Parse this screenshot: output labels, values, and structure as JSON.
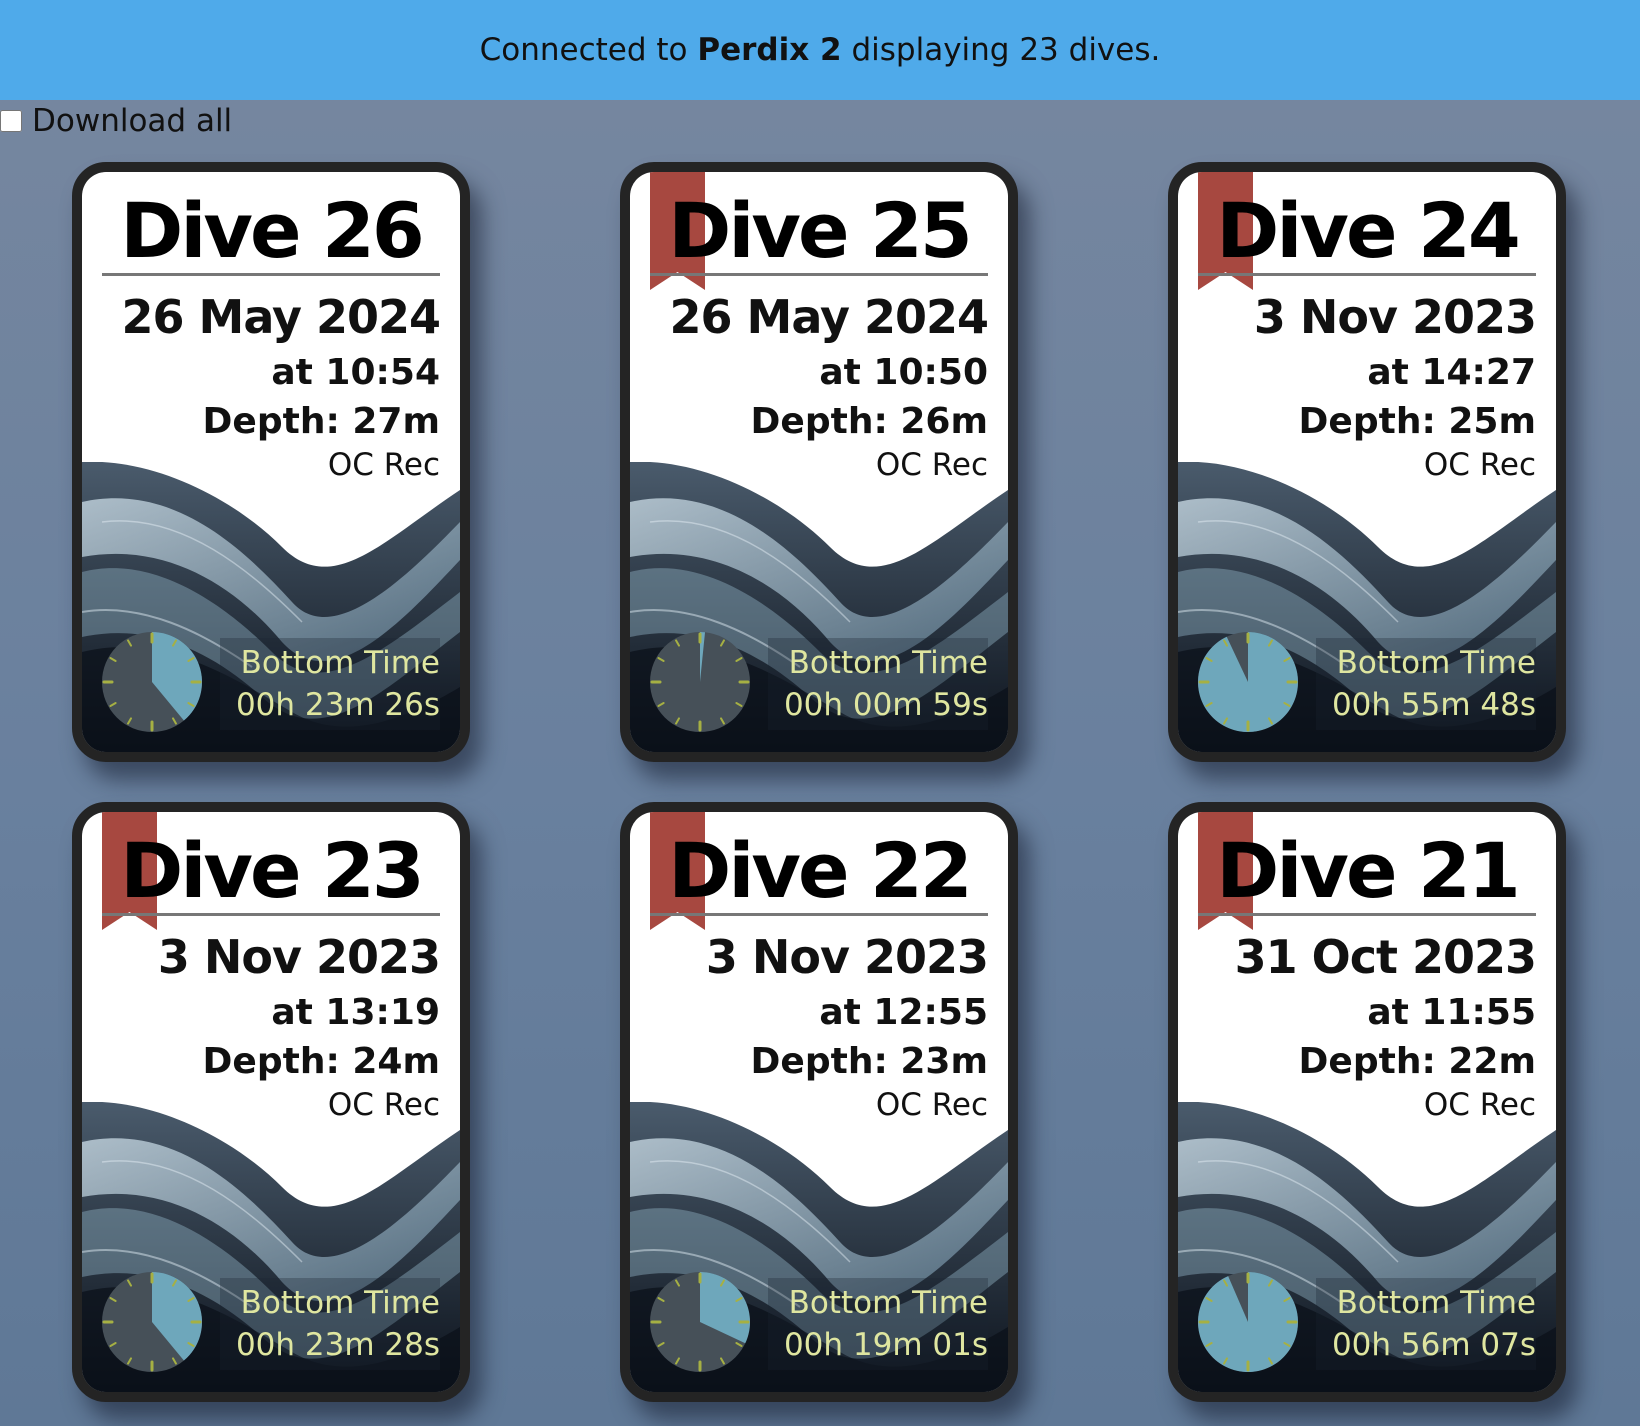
{
  "header": {
    "prefix": "Connected to",
    "device": "Perdix 2",
    "suffix": "displaying 23 dives.",
    "background_color": "#4faaea"
  },
  "download_all": {
    "label": "Download all",
    "checked": false
  },
  "bottom_time_label": "Bottom Time",
  "accent_colors": {
    "ribbon": "#a33f36",
    "bottom_time_text": "#dfe6a0",
    "clock_face": "#465058",
    "clock_fill": "#6ea7bb",
    "clock_tick": "#a6b043"
  },
  "dives": [
    {
      "title": "Dive 26",
      "date": "26 May 2024",
      "time": "at 10:54",
      "depth": "Depth: 27m",
      "mode": "OC Rec",
      "bottom_time": "00h 23m 26s",
      "bookmarked": false,
      "elapsed_fraction": 0.39
    },
    {
      "title": "Dive 25",
      "date": "26 May 2024",
      "time": "at 10:50",
      "depth": "Depth: 26m",
      "mode": "OC Rec",
      "bottom_time": "00h 00m 59s",
      "bookmarked": true,
      "elapsed_fraction": 0.016
    },
    {
      "title": "Dive 24",
      "date": "3 Nov 2023",
      "time": "at 14:27",
      "depth": "Depth: 25m",
      "mode": "OC Rec",
      "bottom_time": "00h 55m 48s",
      "bookmarked": true,
      "elapsed_fraction": 0.93
    },
    {
      "title": "Dive 23",
      "date": "3 Nov 2023",
      "time": "at 13:19",
      "depth": "Depth: 24m",
      "mode": "OC Rec",
      "bottom_time": "00h 23m 28s",
      "bookmarked": true,
      "elapsed_fraction": 0.39
    },
    {
      "title": "Dive 22",
      "date": "3 Nov 2023",
      "time": "at 12:55",
      "depth": "Depth: 23m",
      "mode": "OC Rec",
      "bottom_time": "00h 19m 01s",
      "bookmarked": true,
      "elapsed_fraction": 0.32
    },
    {
      "title": "Dive 21",
      "date": "31 Oct 2023",
      "time": "at 11:55",
      "depth": "Depth: 22m",
      "mode": "OC Rec",
      "bottom_time": "00h 56m 07s",
      "bookmarked": true,
      "elapsed_fraction": 0.935
    }
  ]
}
